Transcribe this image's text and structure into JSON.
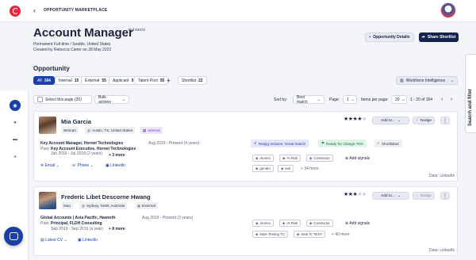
{
  "header": {
    "back_icon": "chevron-left-icon",
    "breadcrumb": "OPPORTUNITY MARKETPLACE"
  },
  "job": {
    "title": "Account Manager",
    "ref": "Ref #2474",
    "type_location": "Permanent Full-time / Seattle, United States",
    "created": "Created by Rebecca Carter on 28 May 2022",
    "details_button": "Opportunity Details",
    "share_button": "Share Shortlist"
  },
  "search_tab": {
    "label": "Search and filter"
  },
  "opportunity": {
    "title": "Opportunity",
    "tabs": [
      {
        "label": "All",
        "count": "164",
        "active": true
      },
      {
        "label": "Internal",
        "count": "15",
        "active": false
      },
      {
        "label": "External",
        "count": "55",
        "active": false
      },
      {
        "label": "Applicant",
        "count": "0",
        "active": false
      },
      {
        "label": "Talent Pool",
        "count": "95",
        "active": false
      },
      {
        "label": "Shortlist",
        "count": "22",
        "active": false
      }
    ],
    "add_tab": "+",
    "workforce_button": "Workforce Intelligence"
  },
  "toolbar": {
    "select_page": "Select this page (20)",
    "bulk_actions": "Bulk actions",
    "sort_label": "Sort by:",
    "sort_value": "Best match",
    "page_label": "Page:",
    "page_value": "1",
    "items_label": "Items per page:",
    "items_value": "20",
    "range": "1 - 20 of 164"
  },
  "candidates": [
    {
      "name": "Mia Garcia",
      "gender": "Woman",
      "location": "Austin, TX, United States",
      "source": "Internal",
      "rating": 4,
      "add_to": "Add to...",
      "nudge": "Nudge",
      "headline": "Key Account Manager, Hornet Technologies",
      "headline_dates": "Aug 2019 - Present (4 years)",
      "past_label": "Past:",
      "past_title": "Key Account Executive, Hornet Technologies",
      "past_dates": "Jun 2016 - Jul 2018 (2 years)",
      "more": "+ 3 more",
      "contacts": [
        "Email",
        "Phone",
        "LinkedIn"
      ],
      "badges": [
        "Reejig reckons: Great match!",
        "Ready for change 76%",
        "Shortlisted"
      ],
      "tags": [
        "Alumni",
        "At Risk",
        "Contractor",
        "gender",
        "test"
      ],
      "tags_more": "+ 34 more",
      "add_signals": "Add signals",
      "data_source": "Data: LinkedIn"
    },
    {
      "name": "Frederic Libet Descorne Hwang",
      "gender": "Man",
      "location": "Sydney, NSW, Australia",
      "source": "External",
      "rating": 3,
      "add_to": "Add to...",
      "nudge": "Nudge",
      "headline": "Global Accounts | Asia Pacific, Haworth",
      "headline_dates": "Aug 2019 - Present (3 years)",
      "past_label": "Past:",
      "past_title": "Principal, FLDH Consulting",
      "past_dates": "Sep 2019 - Sep 2019 (a year)",
      "more": "+ 8 more",
      "contacts": [
        "Latest CV",
        "LinkedIn"
      ],
      "tags": [
        "Alumni",
        "At Risk",
        "Contractor",
        "Male Testing TC",
        "New Tc TEST"
      ],
      "tags_more": "+ 40 more",
      "add_signals": "Add signals",
      "data_source": "Data: LinkedIn"
    }
  ],
  "colors": {
    "primary": "#1a3fa8",
    "navy": "#17234f",
    "brand": "#e8273d"
  }
}
